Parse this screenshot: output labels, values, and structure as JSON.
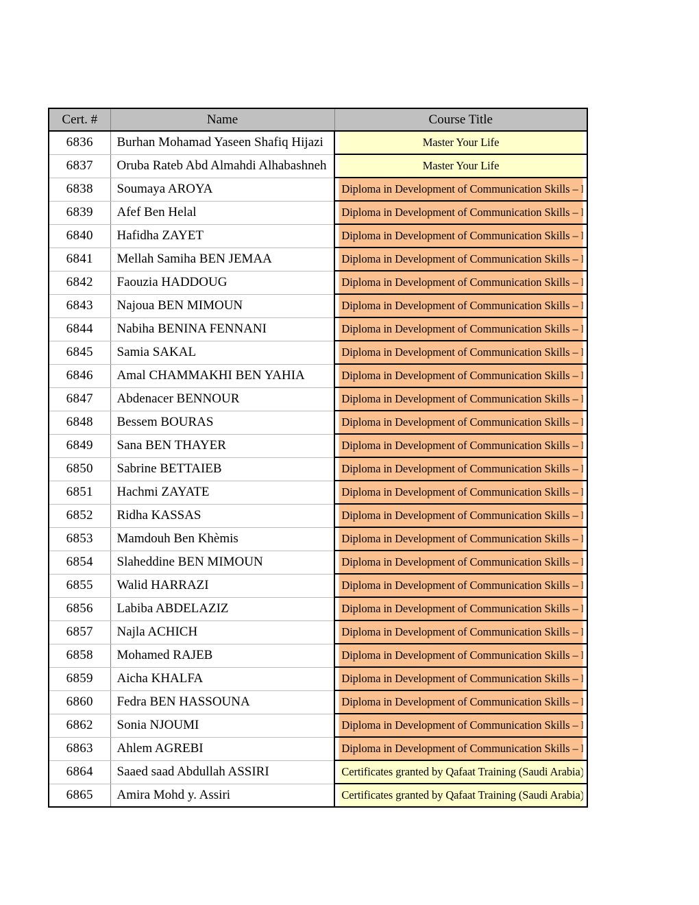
{
  "table": {
    "columns": [
      {
        "key": "cert",
        "label": "Cert. #"
      },
      {
        "key": "name",
        "label": "Name"
      },
      {
        "key": "title",
        "label": "Course Title"
      }
    ],
    "colors": {
      "header_bg": "#c0c0c0",
      "master_your_life_bg": "#ffffcc",
      "diploma_bg": "#fac090",
      "qafaat_bg": "#ffffcc",
      "grid_line": "#bfbfbf",
      "outer_border": "#000000"
    },
    "rows": [
      {
        "cert": "6836",
        "name": "Burhan Mohamad Yaseen Shafiq Hijazi",
        "title": "Master Your Life",
        "fill": "yellow"
      },
      {
        "cert": "6837",
        "name": "Oruba Rateb Abd Almahdi Alhabashneh",
        "title": "Master Your Life",
        "fill": "yellow"
      },
      {
        "cert": "6838",
        "name": "Soumaya AROYA",
        "title": "Diploma in Development of Communication Skills – Level I",
        "fill": "orange"
      },
      {
        "cert": "6839",
        "name": "Afef Ben Helal",
        "title": "Diploma in Development of Communication Skills – Level I",
        "fill": "orange"
      },
      {
        "cert": "6840",
        "name": "Hafidha ZAYET",
        "title": "Diploma in Development of Communication Skills – Level I",
        "fill": "orange"
      },
      {
        "cert": "6841",
        "name": "Mellah Samiha BEN JEMAA",
        "title": "Diploma in Development of Communication Skills – Level I",
        "fill": "orange"
      },
      {
        "cert": "6842",
        "name": "Faouzia HADDOUG",
        "title": "Diploma in Development of Communication Skills – Level I",
        "fill": "orange"
      },
      {
        "cert": "6843",
        "name": "Najoua BEN MIMOUN",
        "title": "Diploma in Development of Communication Skills – Level I",
        "fill": "orange"
      },
      {
        "cert": "6844",
        "name": "Nabiha BENINA FENNANI",
        "title": "Diploma in Development of Communication Skills – Level I",
        "fill": "orange"
      },
      {
        "cert": "6845",
        "name": "Samia SAKAL",
        "title": "Diploma in Development of Communication Skills – Level I",
        "fill": "orange"
      },
      {
        "cert": "6846",
        "name": "Amal CHAMMAKHI BEN YAHIA",
        "title": "Diploma in Development of Communication Skills – Level I",
        "fill": "orange"
      },
      {
        "cert": "6847",
        "name": "Abdenacer BENNOUR",
        "title": "Diploma in Development of Communication Skills – Level I",
        "fill": "orange"
      },
      {
        "cert": "6848",
        "name": "Bessem BOURAS",
        "title": "Diploma in Development of Communication Skills – Level I",
        "fill": "orange"
      },
      {
        "cert": "6849",
        "name": "Sana BEN THAYER",
        "title": "Diploma in Development of Communication Skills – Level I",
        "fill": "orange"
      },
      {
        "cert": "6850",
        "name": "Sabrine BETTAIEB",
        "title": "Diploma in Development of Communication Skills – Level I",
        "fill": "orange"
      },
      {
        "cert": "6851",
        "name": "Hachmi ZAYATE",
        "title": "Diploma in Development of Communication Skills – Level I",
        "fill": "orange"
      },
      {
        "cert": "6852",
        "name": "Ridha KASSAS",
        "title": "Diploma in Development of Communication Skills – Level I",
        "fill": "orange"
      },
      {
        "cert": "6853",
        "name": "Mamdouh Ben Khèmis",
        "title": "Diploma in Development of Communication Skills – Level I",
        "fill": "orange"
      },
      {
        "cert": "6854",
        "name": "Slaheddine BEN MIMOUN",
        "title": "Diploma in Development of Communication Skills – Level I",
        "fill": "orange"
      },
      {
        "cert": "6855",
        "name": "Walid HARRAZI",
        "title": "Diploma in Development of Communication Skills – Level I",
        "fill": "orange"
      },
      {
        "cert": "6856",
        "name": "Labiba ABDELAZIZ",
        "title": "Diploma in Development of Communication Skills – Level I",
        "fill": "orange"
      },
      {
        "cert": "6857",
        "name": "Najla ACHICH",
        "title": "Diploma in Development of Communication Skills – Level I",
        "fill": "orange"
      },
      {
        "cert": "6858",
        "name": "Mohamed RAJEB",
        "title": "Diploma in Development of Communication Skills – Level I",
        "fill": "orange"
      },
      {
        "cert": "6859",
        "name": "Aicha KHALFA",
        "title": "Diploma in Development of Communication Skills – Level I",
        "fill": "orange"
      },
      {
        "cert": "6860",
        "name": "Fedra BEN HASSOUNA",
        "title": "Diploma in Development of Communication Skills – Level I",
        "fill": "orange"
      },
      {
        "cert": "6862",
        "name": "Sonia NJOUMI",
        "title": "Diploma in Development of Communication Skills – Level I",
        "fill": "orange"
      },
      {
        "cert": "6863",
        "name": "Ahlem AGREBI",
        "title": "Diploma in Development of Communication Skills – Level I",
        "fill": "orange"
      },
      {
        "cert": "6864",
        "name": "Saaed saad Abdullah ASSIRI",
        "title": "Certificates granted by Qafaat Training (Saudi Arabia)",
        "fill": "yellow"
      },
      {
        "cert": "6865",
        "name": "Amira Mohd y. Assiri",
        "title": "Certificates granted by Qafaat Training (Saudi Arabia)",
        "fill": "yellow"
      }
    ]
  }
}
